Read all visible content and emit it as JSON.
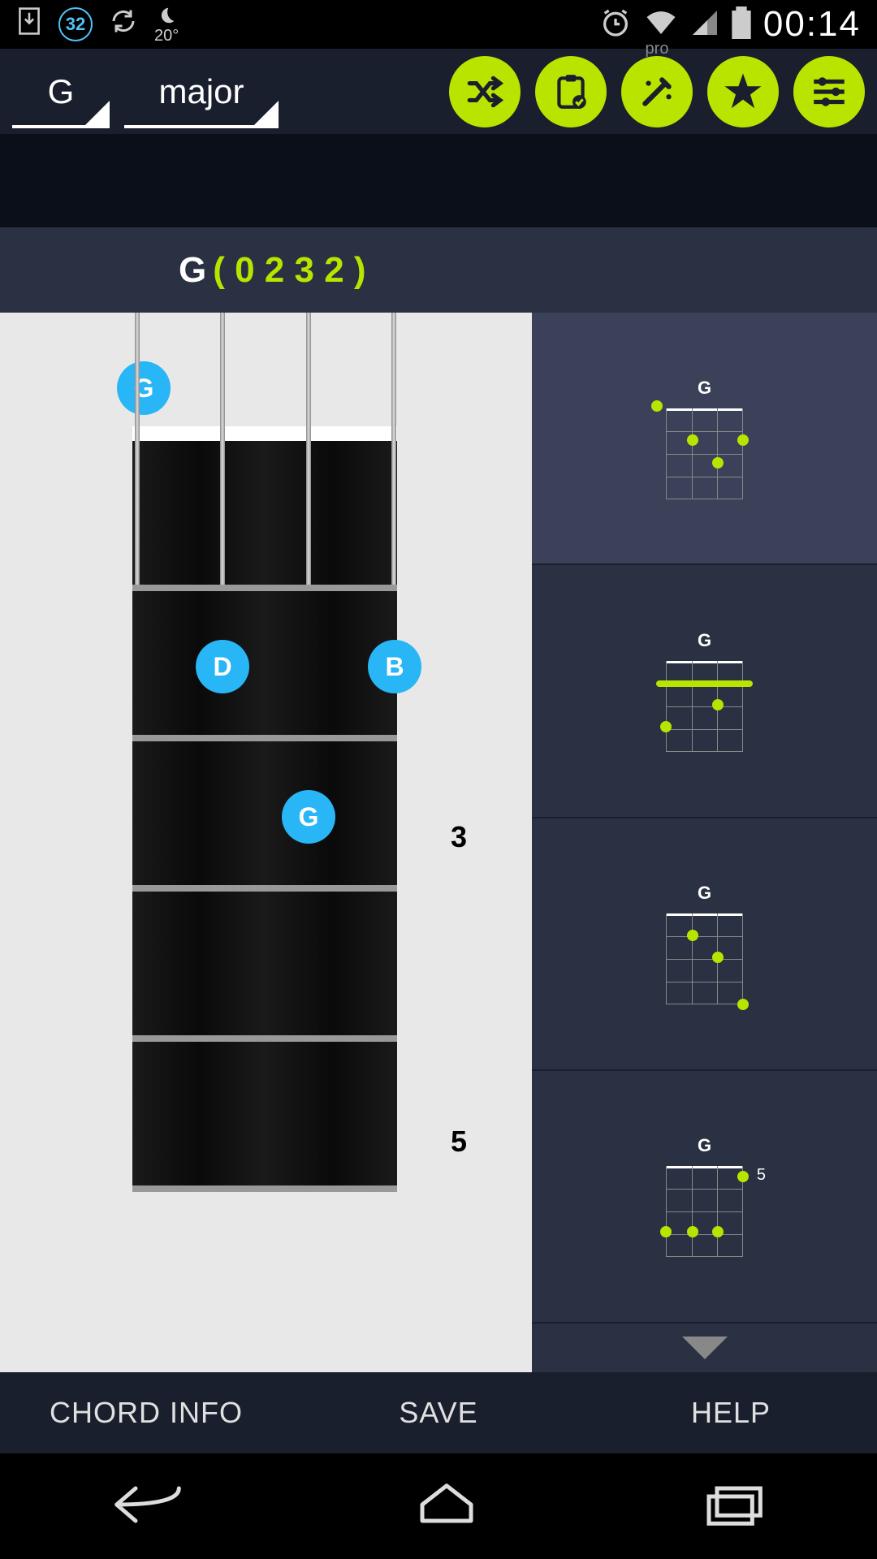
{
  "status": {
    "circled": "32",
    "temp": "20°",
    "time": "00:14"
  },
  "toolbar": {
    "selector1": "G",
    "selector2": "major",
    "pro": "pro"
  },
  "chord": {
    "root": "G",
    "fingering": "( 0 2 3 2 )"
  },
  "fretboard": {
    "open_note": "G",
    "notes": [
      {
        "label": "D"
      },
      {
        "label": "B"
      },
      {
        "label": "G"
      }
    ],
    "fret_markers": {
      "three": "3",
      "five": "5"
    }
  },
  "variations": [
    {
      "label": "G",
      "side": ""
    },
    {
      "label": "G",
      "side": ""
    },
    {
      "label": "G",
      "side": ""
    },
    {
      "label": "G",
      "side": "5"
    }
  ],
  "bottom": {
    "info": "CHORD INFO",
    "save": "SAVE",
    "help": "HELP"
  }
}
